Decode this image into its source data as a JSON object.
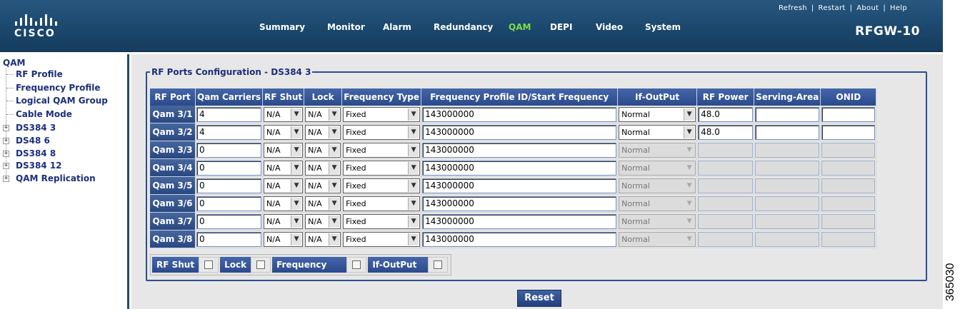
{
  "brand": {
    "logo_text": "CISCO",
    "device_name": "RFGW-10",
    "colors": {
      "header": "#1d4a70",
      "active_tab": "#7dde4d",
      "table_header": "#2c4a8a"
    }
  },
  "util_links": [
    "Refresh",
    "Restart",
    "About",
    "Help"
  ],
  "nav": [
    "Summary",
    "Monitor",
    "Alarm",
    "Redundancy",
    "QAM",
    "DEPI",
    "Video",
    "System"
  ],
  "active_nav": "QAM",
  "sidebar": {
    "root": "QAM",
    "items": [
      "RF Profile",
      "Frequency Profile",
      "Logical QAM Group",
      "Cable Mode"
    ],
    "groups": [
      "DS384 3",
      "DS48 6",
      "DS384 8",
      "DS384 12",
      "QAM Replication"
    ],
    "selected": "DS384 3"
  },
  "panel_title": "RF Ports Configuration - DS384 3",
  "table": {
    "columns": [
      "RF Port",
      "Qam Carriers",
      "RF Shut",
      "Lock",
      "Frequency Type",
      "Frequency Profile ID/Start Frequency",
      "If-OutPut",
      "RF Power",
      "Serving-Area",
      "ONID"
    ],
    "rows": [
      {
        "port": "Qam 3/1",
        "carriers": "4",
        "rf_shut": "N/A",
        "lock": "N/A",
        "freq_type": "Fixed",
        "freq": "143000000",
        "if_output": "Normal",
        "rf_power": "48.0",
        "serving_area": "",
        "onid": "",
        "enabled": true
      },
      {
        "port": "Qam 3/2",
        "carriers": "4",
        "rf_shut": "N/A",
        "lock": "N/A",
        "freq_type": "Fixed",
        "freq": "143000000",
        "if_output": "Normal",
        "rf_power": "48.0",
        "serving_area": "",
        "onid": "",
        "enabled": true
      },
      {
        "port": "Qam 3/3",
        "carriers": "0",
        "rf_shut": "N/A",
        "lock": "N/A",
        "freq_type": "Fixed",
        "freq": "143000000",
        "if_output": "Normal",
        "rf_power": "",
        "serving_area": "",
        "onid": "",
        "enabled": false
      },
      {
        "port": "Qam 3/4",
        "carriers": "0",
        "rf_shut": "N/A",
        "lock": "N/A",
        "freq_type": "Fixed",
        "freq": "143000000",
        "if_output": "Normal",
        "rf_power": "",
        "serving_area": "",
        "onid": "",
        "enabled": false
      },
      {
        "port": "Qam 3/5",
        "carriers": "0",
        "rf_shut": "N/A",
        "lock": "N/A",
        "freq_type": "Fixed",
        "freq": "143000000",
        "if_output": "Normal",
        "rf_power": "",
        "serving_area": "",
        "onid": "",
        "enabled": false
      },
      {
        "port": "Qam 3/6",
        "carriers": "0",
        "rf_shut": "N/A",
        "lock": "N/A",
        "freq_type": "Fixed",
        "freq": "143000000",
        "if_output": "Normal",
        "rf_power": "",
        "serving_area": "",
        "onid": "",
        "enabled": false
      },
      {
        "port": "Qam 3/7",
        "carriers": "0",
        "rf_shut": "N/A",
        "lock": "N/A",
        "freq_type": "Fixed",
        "freq": "143000000",
        "if_output": "Normal",
        "rf_power": "",
        "serving_area": "",
        "onid": "",
        "enabled": false
      },
      {
        "port": "Qam 3/8",
        "carriers": "0",
        "rf_shut": "N/A",
        "lock": "N/A",
        "freq_type": "Fixed",
        "freq": "143000000",
        "if_output": "Normal",
        "rf_power": "",
        "serving_area": "",
        "onid": "",
        "enabled": false
      }
    ]
  },
  "toggles": [
    "RF Shut",
    "Lock",
    "Frequency",
    "If-OutPut"
  ],
  "reset_label": "Reset",
  "figure_number": "365030"
}
